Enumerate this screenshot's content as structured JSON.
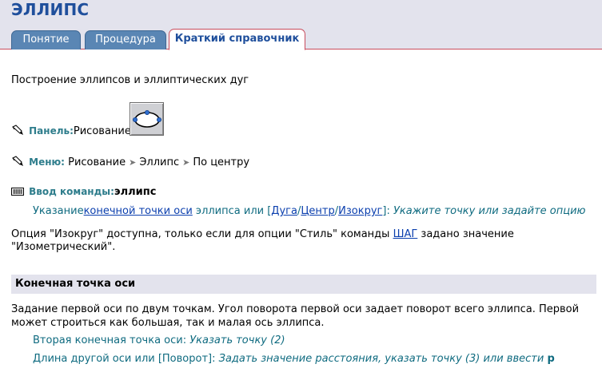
{
  "header": {
    "title": "ЭЛЛИПС",
    "tabs": [
      "Понятие",
      "Процедура",
      "Краткий справочник"
    ]
  },
  "intro": "Построение эллипсов и эллиптических дуг",
  "panel": {
    "label": "Панель:",
    "value": "Рисование"
  },
  "menu": {
    "label": "Меню:",
    "items": [
      "Рисование",
      "Эллипс",
      "По центру"
    ],
    "separator": "➤"
  },
  "command": {
    "label": "Ввод команды:",
    "value": "эллипс"
  },
  "prompt1": {
    "prefix": "Указание",
    "link_axis": "конечной точки оси",
    "middle": " эллипса или [",
    "link_arc": "Дуга",
    "slash1": "/",
    "link_center": "Центр",
    "slash2": "/",
    "link_iso": "Изокруг",
    "suffix": "]: ",
    "hint": "Укажите точку или задайте опцию"
  },
  "note": {
    "before": "Опция \"Изокруг\" доступна, только если для опции \"Стиль\" команды ",
    "link": "ШАГ",
    "after": " задано значение",
    "line2": "\"Изометрический\"."
  },
  "section": {
    "title": "Конечная точка оси",
    "desc_line1": "Задание первой оси по двум точкам. Угол поворота первой оси задает поворот всего эллипса. Первой",
    "desc_line2": "может строиться как большая, так и малая ось эллипса.",
    "prompt2_text": "Вторая конечная точка оси: ",
    "prompt2_hint": "Указать точку (2)",
    "prompt3_text": "Длина другой оси или [Поворот]: ",
    "prompt3_hint": "Задать значение расстояния, указать точку (3) или ввести ",
    "prompt3_key": "р"
  },
  "colors": {
    "tab_bg": "#5a86b4",
    "header_bg": "#e3e3ed",
    "accent_border": "#c84c5c",
    "title": "#1f4f9c",
    "label": "#2e7d8c",
    "link": "#0b3fae"
  }
}
